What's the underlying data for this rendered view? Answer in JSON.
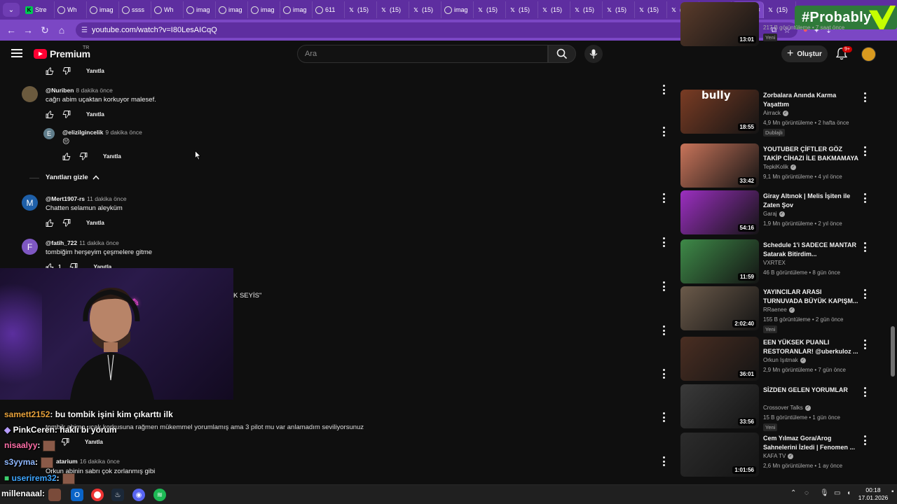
{
  "browser": {
    "tabs": [
      {
        "label": "Stre",
        "icon": "stream-icon"
      },
      {
        "label": "Wh",
        "icon": "globe-icon"
      },
      {
        "label": "imag",
        "icon": "globe-icon"
      },
      {
        "label": "ssss",
        "icon": "globe-icon"
      },
      {
        "label": "Wh",
        "icon": "globe-icon"
      },
      {
        "label": "imag",
        "icon": "globe-icon"
      },
      {
        "label": "imag",
        "icon": "globe-icon"
      },
      {
        "label": "imag",
        "icon": "globe-icon"
      },
      {
        "label": "imag",
        "icon": "globe-icon"
      },
      {
        "label": "611",
        "icon": "globe-icon"
      },
      {
        "label": "(15)",
        "icon": "x-icon"
      },
      {
        "label": "(15)",
        "icon": "x-icon"
      },
      {
        "label": "(15)",
        "icon": "x-icon"
      },
      {
        "label": "imag",
        "icon": "globe-icon"
      },
      {
        "label": "(15)",
        "icon": "x-icon"
      },
      {
        "label": "(15)",
        "icon": "x-icon"
      },
      {
        "label": "(15)",
        "icon": "x-icon"
      },
      {
        "label": "(15)",
        "icon": "x-icon"
      },
      {
        "label": "(15)",
        "icon": "x-icon"
      },
      {
        "label": "(15)",
        "icon": "x-icon"
      },
      {
        "label": "(15)",
        "icon": "x-icon"
      },
      {
        "label": "(15)",
        "icon": "x-icon"
      },
      {
        "label": "",
        "icon": "youtube-icon",
        "active": true
      },
      {
        "label": "(15)",
        "icon": "x-icon"
      }
    ],
    "close_glyph": "×",
    "url": "youtube.com/watch?v=I80LesAICqQ",
    "overlay_brand": "#Probably"
  },
  "youtube": {
    "brand": "Premium",
    "region": "TR",
    "search_placeholder": "Ara",
    "create_label": "Oluştur",
    "notif_count": "9+"
  },
  "comments": {
    "reply_label": "Yanıtla",
    "hide_replies_label": "Yanıtları gizle",
    "items": [
      {
        "author": "@Nuriben",
        "time": "8 dakika önce",
        "text": "cağrı abim uçaktan korkuyor malesef.",
        "avatar_letter": ""
      },
      {
        "author": "@elizilgincelik",
        "time": "9 dakika önce",
        "text": "😔",
        "avatar_letter": "E"
      },
      {
        "author": "@Mert1907-rs",
        "time": "11 dakika önce",
        "text": "Chatten selamun aleyküm",
        "avatar_letter": "M"
      },
      {
        "author": "@fatih_722",
        "time": "11 dakika önce",
        "text": "tombiğim  herşeyim çeşmelere gitme",
        "avatar_letter": "F",
        "likes": "1"
      },
      {
        "text_fragment": "K SEYİS\""
      },
      {
        "text": "tombik abimo ucak korkusuna rağmen mükemmel yorumlamış ama 3 pilot mu var anlamadım seviliyorsunuz"
      },
      {
        "author": "atarium",
        "time": "16 dakika önce",
        "text": "Orkun abinin sabrı çok zorlanmış gibi"
      }
    ]
  },
  "chat": [
    {
      "user": "samett2152",
      "color": "#e8a23b",
      "text": ": bu tombik işini kim çıkarttı ilk"
    },
    {
      "user": "PinkCeren",
      "color": "#ffffff",
      "text": ": haklı bi yorum"
    },
    {
      "user": "nisaalyy",
      "color": "#ff6fa8",
      "text": ":"
    },
    {
      "user": "s3yyma",
      "color": "#8fb8ff",
      "text": ":"
    },
    {
      "user": "userirem32",
      "color": "#3ea6ff",
      "text": ":"
    },
    {
      "user": "millenaaal",
      "color": "#ffffff",
      "text": ":"
    }
  ],
  "sidebar": [
    {
      "title": "",
      "channel": "",
      "stats": "217 B görüntüleme • 7 saat önce",
      "duration": "13:01",
      "badge": "Yeni",
      "thumb_color": "#5a3b2b"
    },
    {
      "title": "Zorbalara Anında Karma Yaşattım",
      "channel": "Airrack",
      "verified": true,
      "stats": "4,9 Mn görüntüleme • 2 hafta önce",
      "duration": "18:55",
      "badge": "Dublajlı",
      "thumb_color": "#7a3c24",
      "thumb_text": "bully"
    },
    {
      "title": "YOUTUBER ÇİFTLER GÖZ TAKİP CİHAZI İLE BAKMAMAYA ...",
      "channel": "TepkiKolik",
      "verified": true,
      "stats": "9,1 Mn görüntüleme • 4 yıl önce",
      "duration": "33:42",
      "thumb_color": "#c8745a"
    },
    {
      "title": "Giray Altınok | Melis İşiten ile Zaten Şov",
      "channel": "Garaj",
      "verified": true,
      "stats": "1,9 Mn görüntüleme • 2 yıl önce",
      "duration": "54:16",
      "thumb_color": "#9b2fc0"
    },
    {
      "title": "Schedule 1'i SADECE MANTAR Satarak Bitirdim...",
      "channel": "VXRTEX",
      "verified": false,
      "stats": "46 B görüntüleme • 8 gün önce",
      "duration": "11:59",
      "thumb_color": "#3e8a48"
    },
    {
      "title": "YAYINCILAR ARASI TURNUVADA BÜYÜK KAPIŞM...",
      "channel": "RRaenee",
      "verified": true,
      "stats": "155 B görüntüleme • 2 gün önce",
      "duration": "2:02:40",
      "badge": "Yeni",
      "thumb_color": "#6b5a4a"
    },
    {
      "title": "EEN YÜKSEK PUANLI RESTORANLAR! @uberkuloz ...",
      "channel": "Orkun Işıtmak",
      "verified": true,
      "stats": "2,9 Mn görüntüleme • 7 gün önce",
      "duration": "36:01",
      "thumb_color": "#4a2e22"
    },
    {
      "title": "SİZDEN GELEN YORUMLAR",
      "channel": "Crossover Talks",
      "verified": true,
      "stats": "15 B görüntüleme • 1 gün önce",
      "duration": "33:56",
      "badge": "Yeni",
      "thumb_color": "#3a3a3a"
    },
    {
      "title": "Cem Yılmaz Gora/Arog Sahnelerini İzledi | Fenomen ...",
      "channel": "KAFA TV",
      "verified": true,
      "stats": "2,6 Mn görüntüleme • 1 ay önce",
      "duration": "1:01:56",
      "thumb_color": "#2c2c2c"
    }
  ],
  "taskbar": {
    "time": "00:18",
    "date": "17.01.2026"
  }
}
